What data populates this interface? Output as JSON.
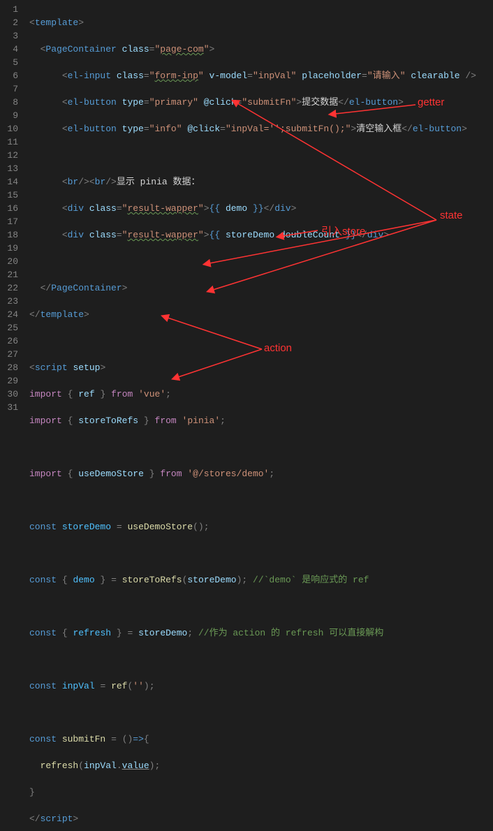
{
  "lines": [
    "1",
    "2",
    "3",
    "4",
    "5",
    "6",
    "7",
    "8",
    "9",
    "10",
    "11",
    "12",
    "13",
    "14",
    "15",
    "16",
    "17",
    "18",
    "19",
    "20",
    "21",
    "22",
    "23",
    "24",
    "25",
    "26",
    "27",
    "28",
    "29",
    "30",
    "31"
  ],
  "code": {
    "l1": {
      "tag_open": "template"
    },
    "l2": {
      "tag": "PageContainer",
      "attr": "class",
      "val": "page-com"
    },
    "l3": {
      "tag": "el-input",
      "a1": "class",
      "v1": "form-inp",
      "a2": "v-model",
      "v2": "inpVal",
      "a3": "placeholder",
      "v3": "请输入",
      "a4": "clearable"
    },
    "l4": {
      "tag": "el-button",
      "a1": "type",
      "v1": "primary",
      "a2": "@click",
      "v2": "submitFn",
      "txt": "提交数据"
    },
    "l5": {
      "tag": "el-button",
      "a1": "type",
      "v1": "info",
      "a2": "@click",
      "v2": "inpVal='';submitFn();",
      "txt": "清空输入框"
    },
    "l7": {
      "txt": "显示 pinia 数据："
    },
    "l8": {
      "tag": "div",
      "a1": "class",
      "v1": "result-wapper",
      "m": "demo"
    },
    "l9": {
      "tag": "div",
      "a1": "class",
      "v1": "result-wapper",
      "m1": "storeDemo",
      "m2": "doubleCount"
    },
    "l11": {
      "tag": "PageContainer"
    },
    "l12": {
      "tag": "template"
    },
    "l14": {
      "tag": "script",
      "attr": "setup"
    },
    "l15": {
      "kw": "import",
      "v": "ref",
      "from": "from",
      "mod": "'vue'"
    },
    "l16": {
      "kw": "import",
      "v": "storeToRefs",
      "from": "from",
      "mod": "'pinia'"
    },
    "l18": {
      "kw": "import",
      "v": "useDemoStore",
      "from": "from",
      "mod": "'@/stores/demo'"
    },
    "l20": {
      "kw": "const",
      "v": "storeDemo",
      "fn": "useDemoStore"
    },
    "l22": {
      "kw": "const",
      "v": "demo",
      "fn": "storeToRefs",
      "arg": "storeDemo",
      "c": "//`demo` 是响应式的 ref"
    },
    "l24": {
      "kw": "const",
      "v": "refresh",
      "rhs": "storeDemo",
      "c": "//作为 action 的 refresh 可以直接解构"
    },
    "l26": {
      "kw": "const",
      "v": "inpVal",
      "fn": "ref",
      "arg": "''"
    },
    "l28": {
      "kw": "const",
      "v": "submitFn"
    },
    "l29": {
      "fn": "refresh",
      "arg1": "inpVal",
      "arg2": "value"
    },
    "l31": {
      "tag": "script"
    }
  },
  "annotations": {
    "getter": "getter",
    "state": "state",
    "import_store": "引入store",
    "action": "action"
  }
}
